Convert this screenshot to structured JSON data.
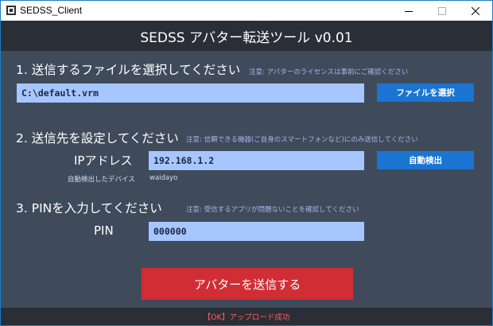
{
  "window": {
    "title": "SEDSS_Client",
    "minimize_glyph": "—",
    "maximize_glyph": "□",
    "close_glyph": "✕"
  },
  "header": {
    "title": "SEDSS アバター転送ツール v0.01"
  },
  "section1": {
    "title": "1. 送信するファイルを選択してください",
    "note": "注意: アバターのライセンスは事前にご確認ください",
    "file_path": "C:\\default.vrm",
    "select_button": "ファイルを選択"
  },
  "section2": {
    "title": "2. 送信先を設定してください",
    "note": "注意: 信頼できる機器(ご自身のスマートフォンなど)にのみ送信してください",
    "ip_label": "IPアドレス",
    "ip_value": "192.168.1.2",
    "detect_button": "自動検出",
    "detected_label": "自動検出したデバイス",
    "detected_value": "waidayo"
  },
  "section3": {
    "title": "3. PINを入力してください",
    "note": "注意: 受信するアプリが問題ないことを確認してください",
    "pin_label": "PIN",
    "pin_value": "000000"
  },
  "send_button": "アバターを送信する",
  "status": "【OK】アップロード成功",
  "colors": {
    "background": "#3f4b5b",
    "header": "#2a2e36",
    "field": "#a6c6ff",
    "button": "#1a75d2",
    "send_button": "#d12d35",
    "note": "#a8b4e8",
    "status": "#ff5a5a"
  }
}
